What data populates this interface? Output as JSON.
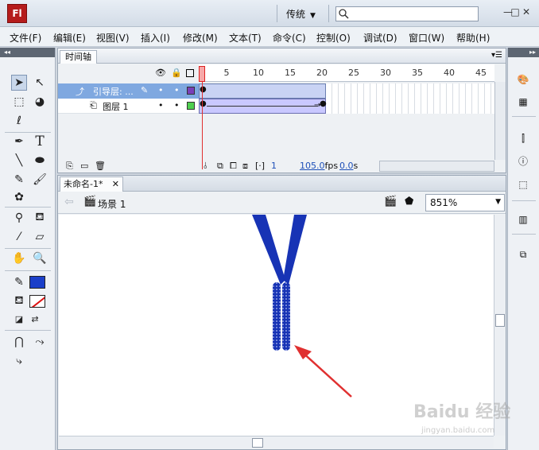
{
  "app": {
    "logo_text": "Fl",
    "workspace": "传统"
  },
  "window_controls": {
    "minimize": "—",
    "restore": "□",
    "close": "✕"
  },
  "menu": [
    "文件(F)",
    "编辑(E)",
    "视图(V)",
    "插入(I)",
    "修改(M)",
    "文本(T)",
    "命令(C)",
    "控制(O)",
    "调试(D)",
    "窗口(W)",
    "帮助(H)"
  ],
  "timeline": {
    "tab_label": "时间轴",
    "ruler": [
      "1",
      "5",
      "10",
      "15",
      "20",
      "25",
      "30",
      "35",
      "40",
      "45"
    ],
    "layers": [
      {
        "name": "引导层: ...",
        "type": "guide",
        "color": "#7a3fb8"
      },
      {
        "name": "图层 1",
        "type": "normal",
        "color": "#4fcf4f"
      }
    ],
    "footer": {
      "current_frame": "1",
      "frame_rate": "105.0",
      "fps_unit": "fps",
      "elapsed": "0.0",
      "elapsed_unit": "s"
    }
  },
  "document": {
    "tab_label": "未命名-1*",
    "scene_label": "场景 1",
    "zoom": "851%"
  },
  "colors": {
    "stroke": "#1b3fc9",
    "fill": "none",
    "accent_red": "#e03030",
    "shape_blue": "#1733b5"
  },
  "watermark": {
    "brand": "Baidu 经验",
    "url": "jingyan.baidu.com"
  },
  "icons": [
    "selection-icon",
    "subselection-icon",
    "free-transform-icon",
    "3d-rotation-icon",
    "lasso-icon",
    "pen-icon",
    "text-icon",
    "line-icon",
    "oval-icon",
    "pencil-icon",
    "brush-icon",
    "deco-icon",
    "bone-icon",
    "paint-bucket-icon",
    "eyedropper-icon",
    "eraser-icon",
    "hand-icon",
    "zoom-icon",
    "stroke-color-icon",
    "fill-color-icon",
    "swap-colors-icon",
    "snap-icon",
    "smooth-icon",
    "straighten-icon"
  ]
}
